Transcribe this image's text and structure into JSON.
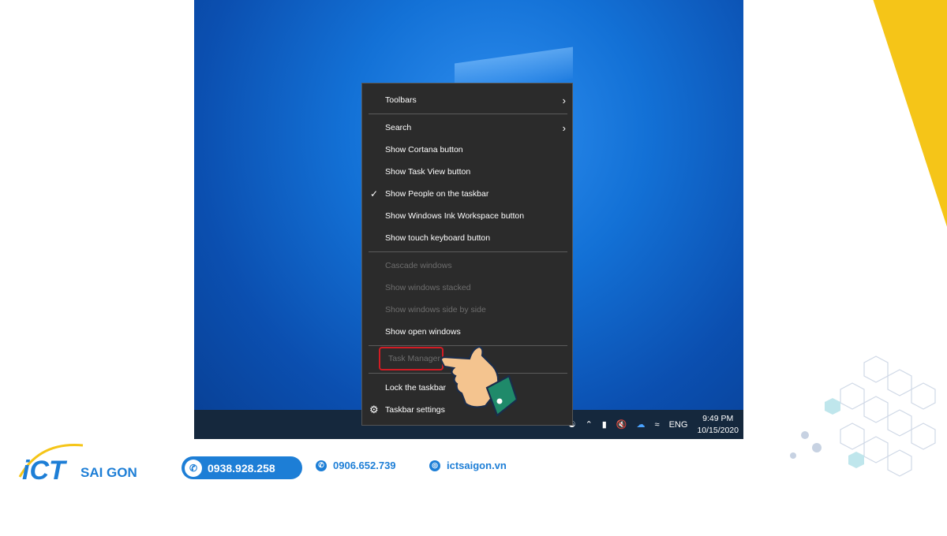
{
  "colors": {
    "accent": "#1d7ed6",
    "yellow": "#f5c518",
    "menu_bg": "#2b2b2b",
    "highlight": "#d11c24"
  },
  "menu": {
    "items": [
      {
        "label": "Toolbars",
        "submenu": true,
        "enabled": true
      },
      {
        "label": "Search",
        "submenu": true,
        "enabled": true
      },
      {
        "label": "Show Cortana button",
        "enabled": true
      },
      {
        "label": "Show Task View button",
        "enabled": true
      },
      {
        "label": "Show People on the taskbar",
        "enabled": true,
        "checked": true
      },
      {
        "label": "Show Windows Ink Workspace button",
        "enabled": true
      },
      {
        "label": "Show touch keyboard button",
        "enabled": true
      },
      {
        "label": "Cascade windows",
        "enabled": false
      },
      {
        "label": "Show windows stacked",
        "enabled": false
      },
      {
        "label": "Show windows side by side",
        "enabled": false
      },
      {
        "label": "Show open windows",
        "enabled": true
      },
      {
        "label": "Task Manager",
        "enabled": false,
        "highlighted": true
      },
      {
        "label": "Lock the taskbar",
        "enabled": true
      },
      {
        "label": "Taskbar settings",
        "enabled": true,
        "icon": "gear-icon"
      }
    ]
  },
  "taskbar": {
    "language": "ENG",
    "time": "9:49 PM",
    "date": "10/15/2020",
    "tray_icons": [
      "people-icon",
      "chevron-up-icon",
      "battery-icon",
      "volume-muted-icon",
      "onedrive-cloud-icon",
      "wifi-icon"
    ]
  },
  "footer": {
    "logo_text": "iCT SAI GON",
    "phone_primary": "0938.928.258",
    "phone_secondary": "0906.652.739",
    "website": "ictsaigon.vn"
  }
}
